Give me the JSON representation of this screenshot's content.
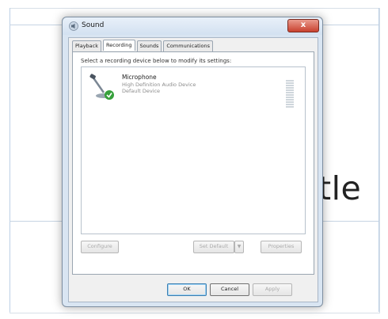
{
  "background": {
    "title_fragment": "tle"
  },
  "dialog": {
    "title": "Sound",
    "close_label": "x",
    "tabs": [
      {
        "label": "Playback",
        "active": false
      },
      {
        "label": "Recording",
        "active": true
      },
      {
        "label": "Sounds",
        "active": false
      },
      {
        "label": "Communications",
        "active": false
      }
    ],
    "instruction": "Select a recording device below to modify its settings:",
    "devices": [
      {
        "name": "Microphone",
        "description": "High Definition Audio Device",
        "status": "Default Device",
        "icon": "microphone-icon",
        "status_badge": "green-check"
      }
    ],
    "buttons": {
      "configure": "Configure",
      "set_default": "Set Default",
      "dropdown_arrow": "▼",
      "properties": "Properties",
      "ok": "OK",
      "cancel": "Cancel",
      "apply": "Apply"
    }
  },
  "colors": {
    "close_button": "#c9412f",
    "check_badge": "#36a03b"
  }
}
